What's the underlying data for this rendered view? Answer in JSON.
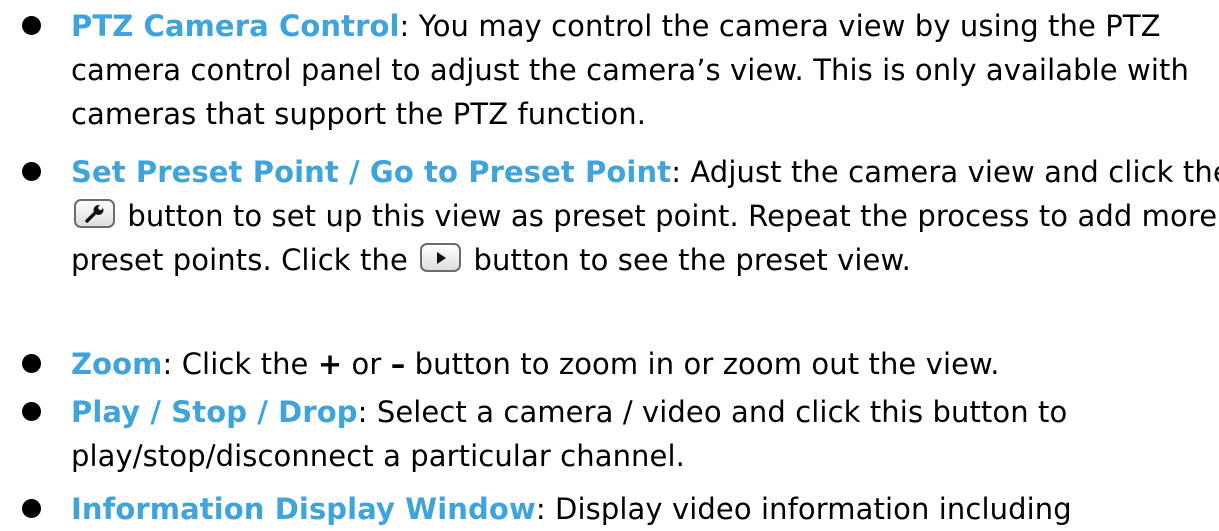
{
  "items": [
    {
      "term": "PTZ Camera Control",
      "text": ": You may control the camera view by using the PTZ camera control panel to adjust the camera’s view. This is only available with cameras that support the PTZ function."
    },
    {
      "term": "Set Preset Point / Go to Preset Point",
      "text_a": ": Adjust the camera view and click the ",
      "icon_a": "wrench-icon",
      "text_b": " button to set up this view as preset point. Repeat the process to add more preset points. Click the ",
      "icon_b": "play-icon",
      "text_c": " button to see the preset view."
    },
    {
      "term": "Zoom",
      "text_a": ": Click the ",
      "plus": "+",
      "text_b": " or ",
      "minus": "–",
      "text_c": " button to zoom in or zoom out the view."
    },
    {
      "term": "Play / Stop / Drop",
      "text": ": Select a camera / video and click this button to play/stop/disconnect a particular channel."
    },
    {
      "term": "Information Display Window",
      "text": ": Display video information including"
    }
  ],
  "colors": {
    "term": "#3fa3dc",
    "bullet": "#000000",
    "text": "#000000"
  }
}
